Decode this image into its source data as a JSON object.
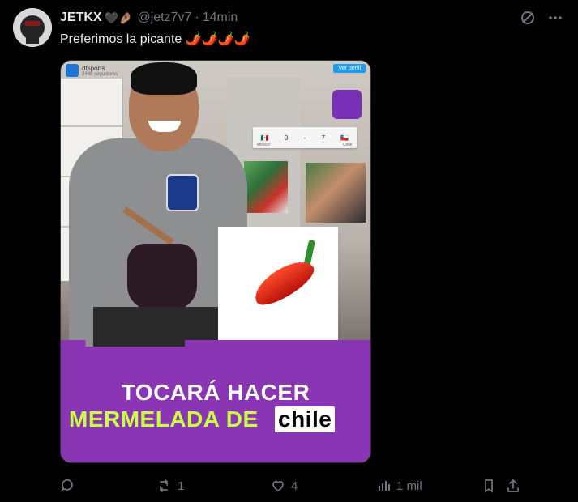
{
  "tweet": {
    "author_name": "JETKX",
    "author_emojis": "🖤🤌🏽",
    "handle": "@jetz7v7",
    "separator": "·",
    "time": "14min",
    "text": "Preferimos la picante 🌶️🌶️🌶️🌶️"
  },
  "media": {
    "account_label": "dtsports",
    "account_followers": "2468 seguidores",
    "profile_button": "Ver perfil",
    "scoreboard": {
      "left_score": "0",
      "right_score": "7",
      "left_team": "México",
      "right_team": "Chile"
    },
    "headline_line1": "TOCARÁ HACER",
    "headline_line2": "MERMELADA DE",
    "headline_highlight": "chile"
  },
  "actions": {
    "replies": "",
    "retweets": "1",
    "likes": "4",
    "views": "1 mil"
  },
  "icons": {
    "menu": "more-horizontal-icon",
    "grok": "grok-icon",
    "reply": "reply-icon",
    "retweet": "retweet-icon",
    "like": "heart-icon",
    "views": "views-icon",
    "bookmark": "bookmark-icon",
    "share": "share-icon"
  }
}
